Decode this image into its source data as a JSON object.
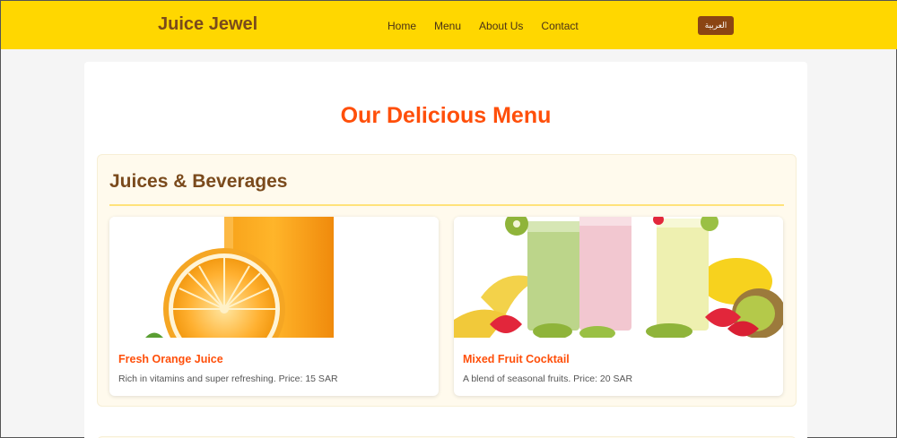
{
  "header": {
    "brand": "Juice Jewel",
    "nav": [
      "Home",
      "Menu",
      "About Us",
      "Contact"
    ],
    "lang_button": "العربية"
  },
  "main": {
    "title": "Our Delicious Menu",
    "section": {
      "title": "Juices & Beverages",
      "items": [
        {
          "name": "Fresh Orange Juice",
          "description": "Rich in vitamins and super refreshing. Price: 15 SAR",
          "image": "orange-juice-image"
        },
        {
          "name": "Mixed Fruit Cocktail",
          "description": "A blend of seasonal fruits. Price: 20 SAR",
          "image": "fruit-smoothies-image"
        }
      ]
    }
  },
  "colors": {
    "header_bg": "#ffd700",
    "brand": "#7a4a1c",
    "accent": "#ff4f0a",
    "lang_button_bg": "#8b4513",
    "section_bg": "#fffaed"
  }
}
